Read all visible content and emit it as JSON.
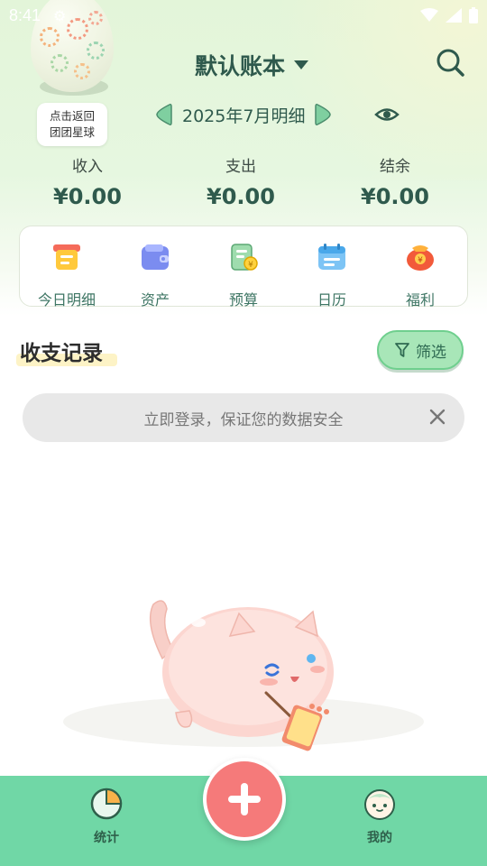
{
  "status_bar": {
    "time": "8:41"
  },
  "egg": {
    "label_line1": "点击返回",
    "label_line2": "团团星球"
  },
  "header": {
    "book_title": "默认账本"
  },
  "month": {
    "label": "2025年7月明细"
  },
  "summary": [
    {
      "label": "收入",
      "value": "¥0.00"
    },
    {
      "label": "支出",
      "value": "¥0.00"
    },
    {
      "label": "结余",
      "value": "¥0.00"
    }
  ],
  "quick_menu": [
    {
      "label": "今日明细",
      "icon": "list-icon"
    },
    {
      "label": "资产",
      "icon": "wallet-icon"
    },
    {
      "label": "预算",
      "icon": "budget-icon"
    },
    {
      "label": "日历",
      "icon": "calendar-icon"
    },
    {
      "label": "福利",
      "icon": "red-envelope-icon"
    }
  ],
  "records": {
    "title": "收支记录",
    "filter_label": "筛选"
  },
  "login_banner": {
    "text": "立即登录，保证您的数据安全"
  },
  "bottom_nav": {
    "stats_label": "统计",
    "mine_label": "我的"
  },
  "colors": {
    "accent_green": "#70d7a6",
    "add_button": "#f57a7a",
    "title_green": "#2f5a4d"
  }
}
